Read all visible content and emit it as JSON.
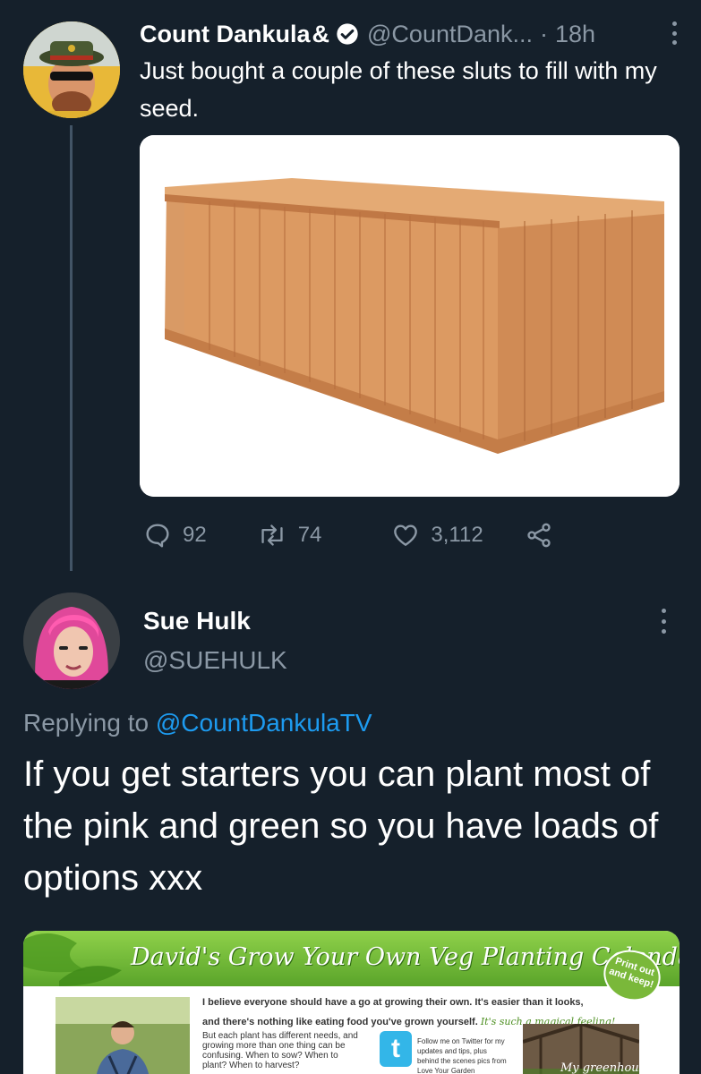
{
  "tweet1": {
    "display_name": "Count Dankula",
    "name_glyph": "&",
    "handle": "@CountDank...",
    "separator": "·",
    "time": "18h",
    "text": "Just bought a couple of these sluts to fill with my seed.",
    "replies": "92",
    "retweets": "74",
    "likes": "3,112"
  },
  "tweet2": {
    "display_name": "Sue Hulk",
    "handle": "@SUEHULK",
    "replying_prefix": "Replying to",
    "replying_to": "@CountDankulaTV",
    "text": "If you get starters you can plant most of the pink and green so you have loads of options xxx"
  },
  "calendar": {
    "title": "David's Grow Your Own Veg Planting Calendar",
    "badge": "Print out and keep!",
    "intro_line1": "I believe everyone should have a go at growing their own. It's easier than it looks,",
    "intro_line2": "and there's nothing like eating food you've grown yourself.",
    "intro_script": "It's such a magical feeling!",
    "body": "But each plant has different needs, and growing more than one thing can be confusing. When to sow? When to plant? When to harvest?",
    "follow": "Follow me on Twitter for my updates and tips, plus behind the scenes pics from Love Your Garden",
    "greenhouse_label": "My greenhouse"
  },
  "icons": {
    "verified": "verified-badge-icon",
    "more": "more-options-icon",
    "reply": "reply-icon",
    "retweet": "retweet-icon",
    "like": "heart-icon",
    "share": "share-icon"
  },
  "colors": {
    "background": "#15202b",
    "secondary_text": "#8b98a5",
    "link": "#1d9bf0",
    "thread_line": "#425466"
  }
}
